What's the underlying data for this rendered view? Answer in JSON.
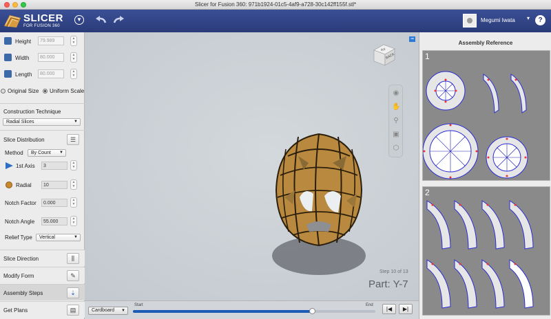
{
  "window": {
    "title": "Slicer for Fusion 360: 971b1924-01c5-4af9-a728-30c142ff155f.stl*"
  },
  "app": {
    "logo_title": "SLICER",
    "logo_subtitle": "FOR FUSION 360",
    "menu_icon": "chevron-circle-down-icon",
    "undo_icon": "undo-arrow-icon",
    "redo_icon": "redo-arrow-icon",
    "user_name": "Megumi Iwata",
    "user_caret": "▾",
    "help_label": "?"
  },
  "dimensions": [
    {
      "label": "Height",
      "value": "79.989",
      "icon": "height-cube-icon"
    },
    {
      "label": "Width",
      "value": "80.000",
      "icon": "width-cube-icon"
    },
    {
      "label": "Length",
      "value": "80.000",
      "icon": "length-cube-icon"
    }
  ],
  "scale": {
    "original_label": "Original Size",
    "uniform_label": "Uniform Scale",
    "selected": "uniform"
  },
  "construction": {
    "title": "Construction Technique",
    "value": "Radial Slices"
  },
  "distribution": {
    "title": "Slice Distribution",
    "method_label": "Method",
    "method_value": "By Count",
    "axis_label": "1st Axis",
    "axis_value": "3",
    "radial_label": "Radial",
    "radial_value": "10",
    "notch_factor_label": "Notch Factor",
    "notch_factor_value": "0.000",
    "notch_angle_label": "Notch Angle",
    "notch_angle_value": "55.000",
    "relief_label": "Relief Type",
    "relief_value": "Vertical"
  },
  "bottom_buttons": [
    {
      "label": "Slice Direction",
      "icon": "slice-direction-icon",
      "glyph": "⫼"
    },
    {
      "label": "Modify Form",
      "icon": "modify-form-icon",
      "glyph": "✎"
    },
    {
      "label": "Assembly Steps",
      "icon": "assembly-steps-icon",
      "glyph": "⇣"
    },
    {
      "label": "Get Plans",
      "icon": "get-plans-icon",
      "glyph": "▤"
    }
  ],
  "viewport": {
    "cube_top": "dcll",
    "cube_front": "BACK",
    "step_text": "Step 10 of 13",
    "part_text": "Part: Y-7",
    "model_color": "#b8893e"
  },
  "timeline": {
    "material_value": "Cardboard",
    "start_label": "Start",
    "end_label": "End",
    "progress": 0.74,
    "prev_glyph": "|◀",
    "next_glyph": "▶|"
  },
  "assembly": {
    "title": "Assembly Reference",
    "groups": [
      {
        "number": "1"
      },
      {
        "number": "2"
      }
    ]
  }
}
